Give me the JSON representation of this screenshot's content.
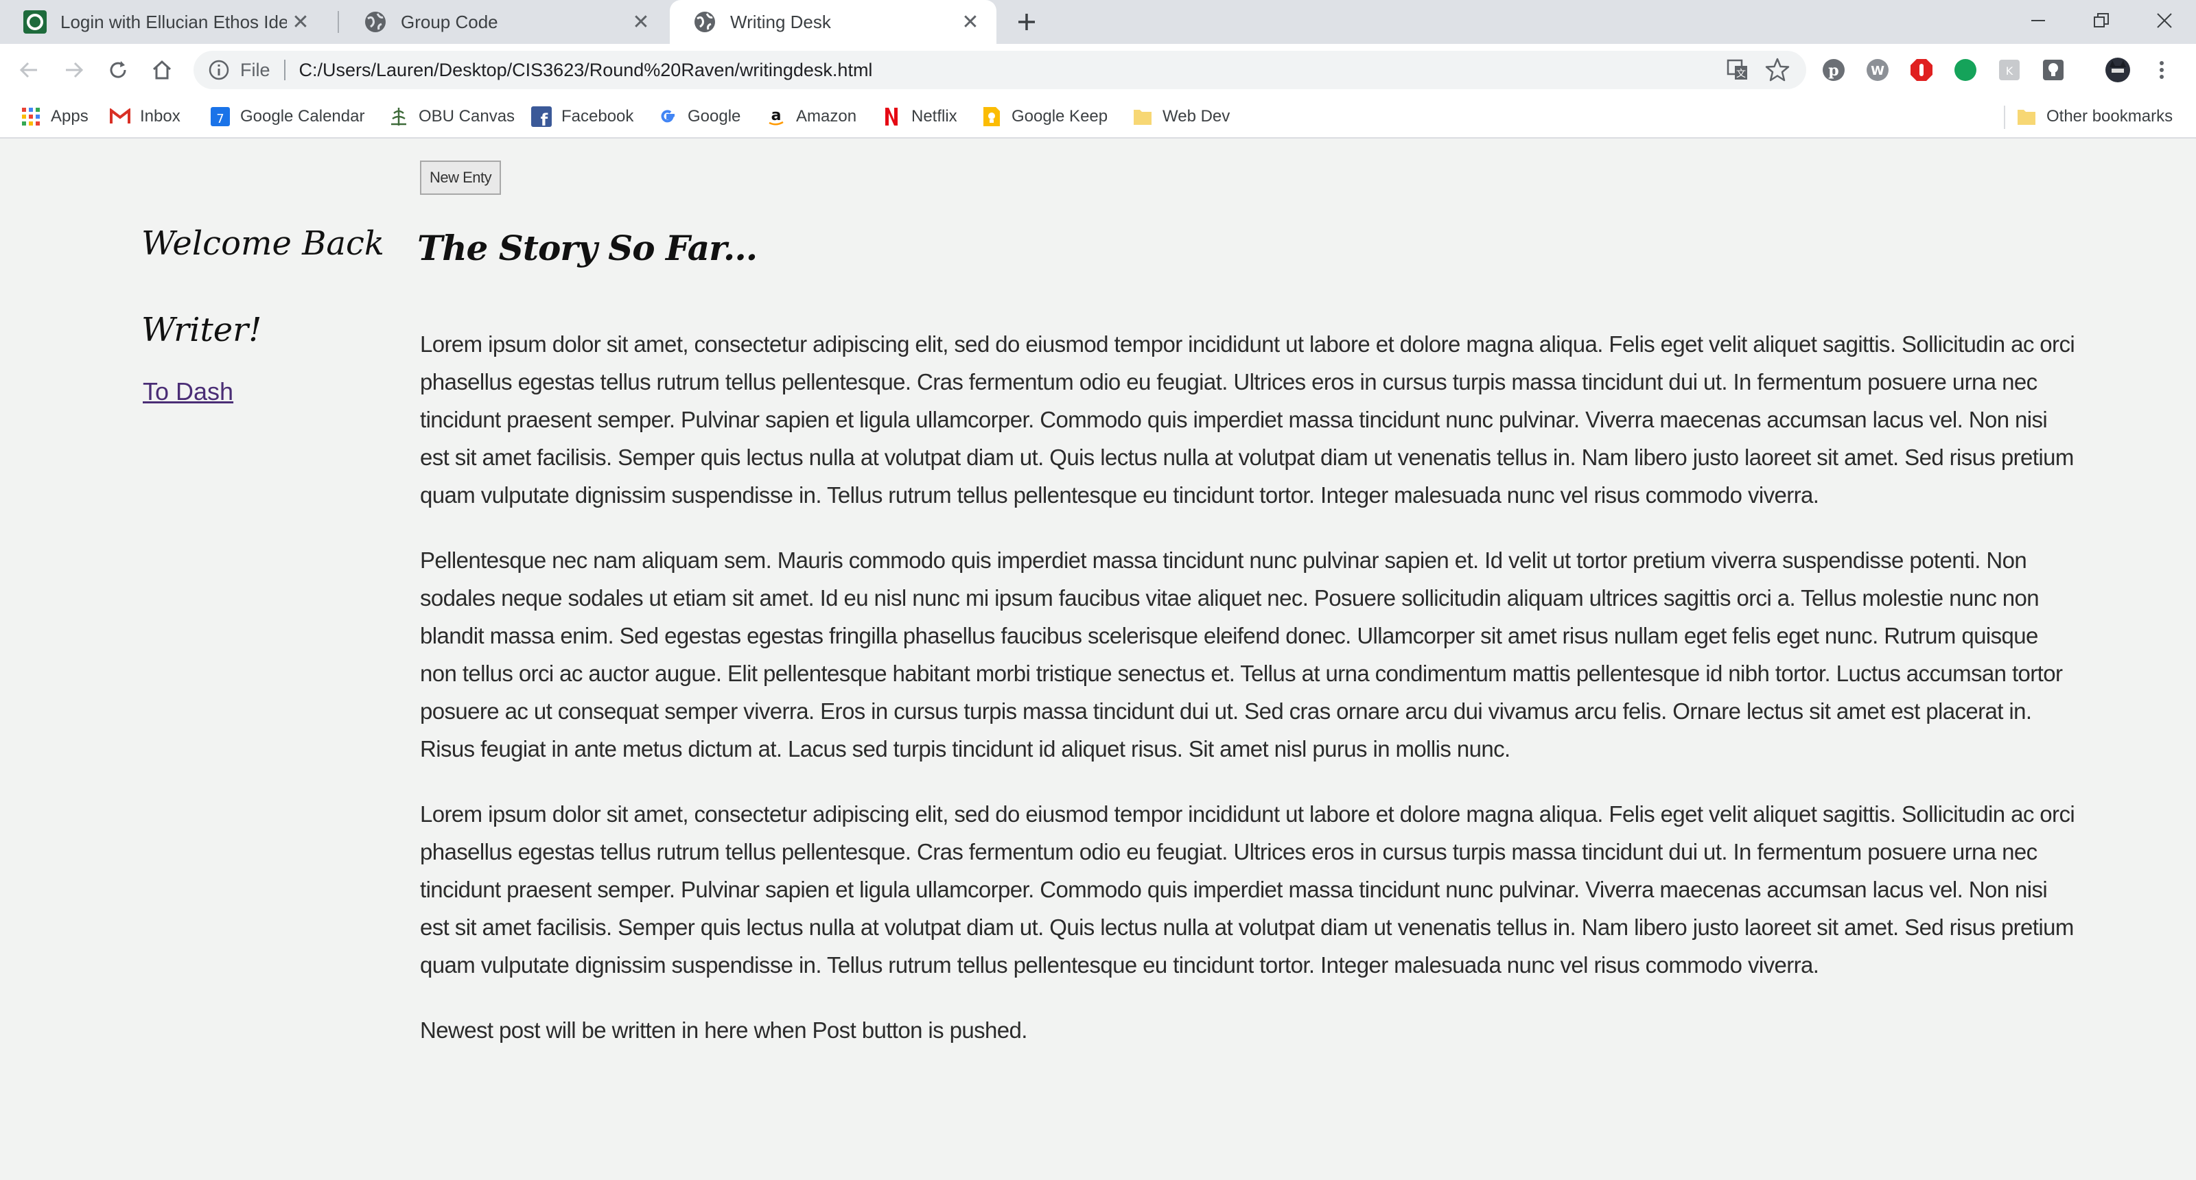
{
  "browser": {
    "tabs": [
      {
        "title": "Login with Ellucian Ethos Identity",
        "icon": "ellucian-icon",
        "active": false
      },
      {
        "title": "Group Code",
        "icon": "globe-icon",
        "active": false
      },
      {
        "title": "Writing Desk",
        "icon": "globe-icon",
        "active": true
      }
    ],
    "address": {
      "scheme_label": "File",
      "url": "C:/Users/Lauren/Desktop/CIS3623/Round%20Raven/writingdesk.html"
    },
    "bookmarks": [
      {
        "label": "Apps",
        "icon": "apps-grid-icon"
      },
      {
        "label": "Inbox",
        "icon": "gmail-icon"
      },
      {
        "label": "Google Calendar",
        "icon": "calendar-icon"
      },
      {
        "label": "OBU Canvas",
        "icon": "canvas-icon"
      },
      {
        "label": "Facebook",
        "icon": "facebook-icon"
      },
      {
        "label": "Google",
        "icon": "google-icon"
      },
      {
        "label": "Amazon",
        "icon": "amazon-icon"
      },
      {
        "label": "Netflix",
        "icon": "netflix-icon"
      },
      {
        "label": "Google Keep",
        "icon": "keep-icon"
      },
      {
        "label": "Web Dev",
        "icon": "folder-icon"
      }
    ],
    "other_bookmarks": "Other bookmarks"
  },
  "page": {
    "new_entry_button": "New Enty",
    "welcome_line1": "Welcome Back",
    "welcome_line2": "Writer!",
    "to_dash_link": "To Dash",
    "story_title": "The Story So Far...",
    "paragraphs": [
      "Lorem ipsum dolor sit amet, consectetur adipiscing elit, sed do eiusmod tempor incididunt ut labore et dolore magna aliqua. Felis eget velit aliquet sagittis. Sollicitudin ac orci phasellus egestas tellus rutrum tellus pellentesque. Cras fermentum odio eu feugiat. Ultrices eros in cursus turpis massa tincidunt dui ut. In fermentum posuere urna nec tincidunt praesent semper. Pulvinar sapien et ligula ullamcorper. Commodo quis imperdiet massa tincidunt nunc pulvinar. Viverra maecenas accumsan lacus vel. Non nisi est sit amet facilisis. Semper quis lectus nulla at volutpat diam ut. Quis lectus nulla at volutpat diam ut venenatis tellus in. Nam libero justo laoreet sit amet. Sed risus pretium quam vulputate dignissim suspendisse in. Tellus rutrum tellus pellentesque eu tincidunt tortor. Integer malesuada nunc vel risus commodo viverra.",
      "Pellentesque nec nam aliquam sem. Mauris commodo quis imperdiet massa tincidunt nunc pulvinar sapien et. Id velit ut tortor pretium viverra suspendisse potenti. Non sodales neque sodales ut etiam sit amet. Id eu nisl nunc mi ipsum faucibus vitae aliquet nec. Posuere sollicitudin aliquam ultrices sagittis orci a. Tellus molestie nunc non blandit massa enim. Sed egestas egestas fringilla phasellus faucibus scelerisque eleifend donec. Ullamcorper sit amet risus nullam eget felis eget nunc. Rutrum quisque non tellus orci ac auctor augue. Elit pellentesque habitant morbi tristique senectus et. Tellus at urna condimentum mattis pellentesque id nibh tortor. Luctus accumsan tortor posuere ac ut consequat semper viverra. Eros in cursus turpis massa tincidunt dui ut. Sed cras ornare arcu dui vivamus arcu felis. Ornare lectus sit amet est placerat in. Risus feugiat in ante metus dictum at. Lacus sed turpis tincidunt id aliquet risus. Sit amet nisl purus in mollis nunc.",
      "Lorem ipsum dolor sit amet, consectetur adipiscing elit, sed do eiusmod tempor incididunt ut labore et dolore magna aliqua. Felis eget velit aliquet sagittis. Sollicitudin ac orci phasellus egestas tellus rutrum tellus pellentesque. Cras fermentum odio eu feugiat. Ultrices eros in cursus turpis massa tincidunt dui ut. In fermentum posuere urna nec tincidunt praesent semper. Pulvinar sapien et ligula ullamcorper. Commodo quis imperdiet massa tincidunt nunc pulvinar. Viverra maecenas accumsan lacus vel. Non nisi est sit amet facilisis. Semper quis lectus nulla at volutpat diam ut. Quis lectus nulla at volutpat diam ut venenatis tellus in. Nam libero justo laoreet sit amet. Sed risus pretium quam vulputate dignissim suspendisse in. Tellus rutrum tellus pellentesque eu tincidunt tortor. Integer malesuada nunc vel risus commodo viverra.",
      "Newest post will be written in here when Post button is pushed."
    ]
  }
}
